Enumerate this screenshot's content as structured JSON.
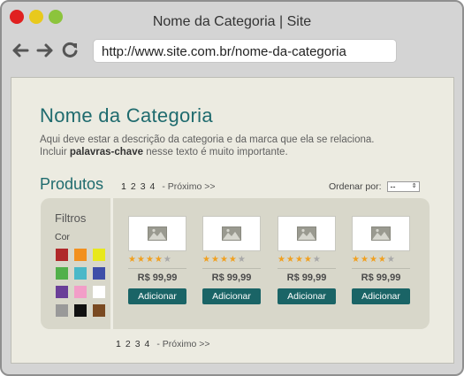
{
  "window": {
    "title": "Nome da Categoria | Site",
    "address": "http://www.site.com.br/nome-da-categoria",
    "controls": [
      "close",
      "minimize",
      "maximize"
    ],
    "nav_icons": [
      "arrow-left-icon",
      "arrow-right-icon",
      "refresh-icon"
    ]
  },
  "category": {
    "title": "Nome da Categoria",
    "desc_line1": "Aqui deve estar a descrição da categoria e da marca que ela se relaciona.",
    "desc_line2_prefix": "Incluir ",
    "desc_line2_bold": "palavras-chave",
    "desc_line2_suffix": " nesse texto é muito importante."
  },
  "products_section": {
    "title": "Produtos",
    "pagination": {
      "pages": [
        "1",
        "2",
        "3",
        "4"
      ],
      "next": "- Próximo >>"
    },
    "order": {
      "label": "Ordenar por:",
      "selected": "--"
    }
  },
  "filters": {
    "title": "Filtros",
    "color_label": "Cor",
    "colors": [
      "#b0282a",
      "#f2901e",
      "#e8e81c",
      "#52b04a",
      "#4ab8c8",
      "#3e4ea8",
      "#6a3e98",
      "#f29ec8",
      "#ffffff",
      "#999999",
      "#111111",
      "#7a4a22"
    ]
  },
  "colors": {
    "accent": "#1f6b6e",
    "button": "#1a6466",
    "star_on": "#f0a020",
    "star_off": "#a8a8a8",
    "panel": "#d8d7ca",
    "page_bg": "#ecebe1"
  },
  "products": [
    {
      "price": "R$ 99,99",
      "button": "Adicionar",
      "rating": 4,
      "max_rating": 5,
      "image_icon": "image-placeholder-icon"
    },
    {
      "price": "R$ 99,99",
      "button": "Adicionar",
      "rating": 4,
      "max_rating": 5,
      "image_icon": "image-placeholder-icon"
    },
    {
      "price": "R$ 99,99",
      "button": "Adicionar",
      "rating": 4,
      "max_rating": 5,
      "image_icon": "image-placeholder-icon"
    },
    {
      "price": "R$ 99,99",
      "button": "Adicionar",
      "rating": 4,
      "max_rating": 5,
      "image_icon": "image-placeholder-icon"
    }
  ]
}
